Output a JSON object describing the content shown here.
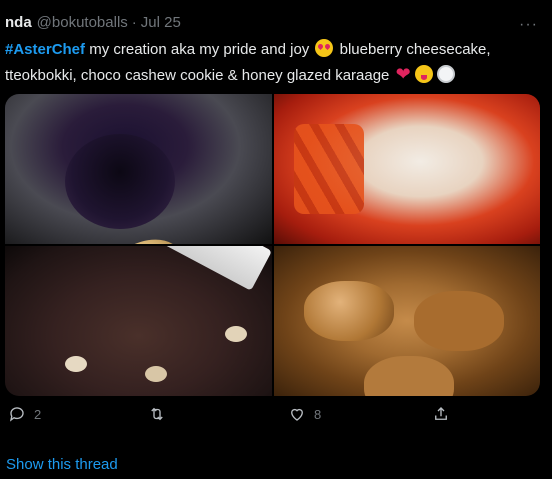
{
  "tweet": {
    "author_name": "nda",
    "author_handle": "@bokutoballs",
    "separator": "·",
    "date": "Jul 25",
    "more_icon": "···",
    "hashtag": "#AsterChef",
    "text_part1": " my creation aka my pride and joy ",
    "text_part2": " blueberry cheesecake,",
    "text_part3": "tteokbokki, choco cashew cookie & honey glazed karaage ",
    "heart": "❤",
    "emojis": [
      "heart-eyes-emoji",
      "red-heart-emoji",
      "yum-emoji",
      "plate-emoji"
    ]
  },
  "actions": {
    "reply_count": "2",
    "retweet_count": "",
    "like_count": "8",
    "share_count": ""
  },
  "show_thread": "Show this thread",
  "colors": {
    "background": "#000000",
    "text": "#e7e9ea",
    "muted": "#71767b",
    "link": "#1d9bf0"
  }
}
